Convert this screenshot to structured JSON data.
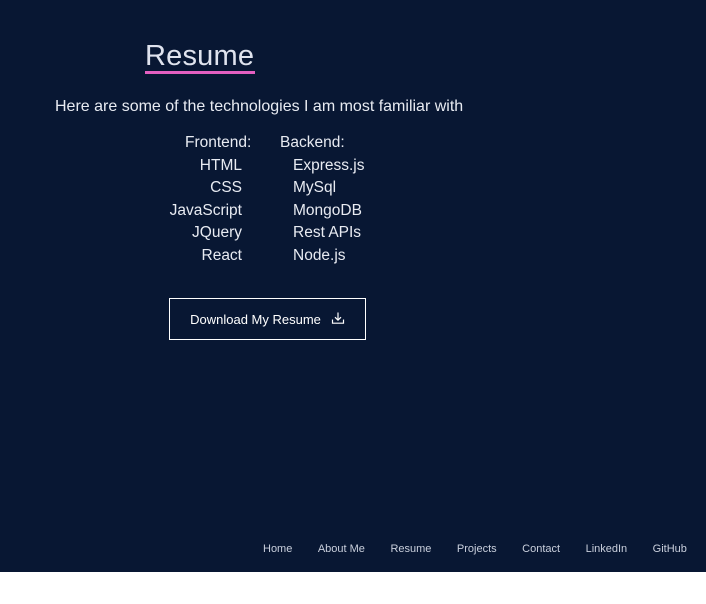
{
  "heading": {
    "title": "Resume",
    "accent_color": "#e35fc1",
    "background_color": "#081733"
  },
  "intro": "Here are some of the technologies I am most familiar with",
  "skills": {
    "frontend_label": "Frontend:",
    "backend_label": "Backend:",
    "frontend": [
      "HTML",
      "CSS",
      "JavaScript",
      "JQuery",
      "React"
    ],
    "backend": [
      "Express.js",
      "MySql",
      "MongoDB",
      "Rest APIs",
      "Node.js"
    ]
  },
  "download": {
    "label": "Download My Resume",
    "icon": "download-icon"
  },
  "nav": {
    "items": [
      "Home",
      "About Me",
      "Resume",
      "Projects",
      "Contact",
      "LinkedIn",
      "GitHub"
    ]
  }
}
